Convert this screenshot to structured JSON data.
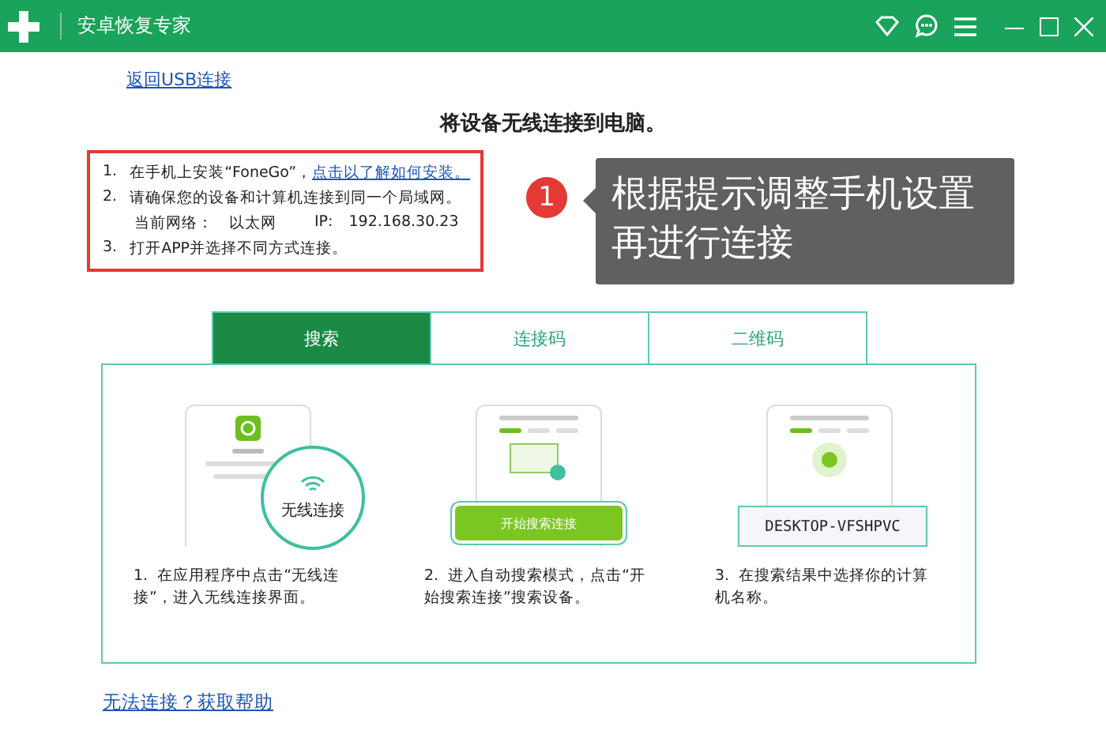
{
  "window": {
    "title": "安卓恢复专家"
  },
  "back_link": "返回USB连接",
  "heading": "将设备无线连接到电脑。",
  "instructions": [
    {
      "number": "1.",
      "text": "在手机上安装“FoneGo”，",
      "link": "点击以了解如何安装。"
    },
    {
      "number": "2.",
      "text": "请确保您的设备和计算机连接到同一个局域网。",
      "network_label": "当前网络：",
      "network": "以太网",
      "ip_label": "IP:",
      "ip": "192.168.30.23"
    },
    {
      "number": "3.",
      "text": "打开APP并选择不同方式连接。"
    }
  ],
  "annotation": {
    "badge": "1",
    "text": "根据提示调整手机设置再进行连接"
  },
  "tabs": [
    {
      "label": "搜索",
      "selected": true
    },
    {
      "label": "连接码",
      "selected": false
    },
    {
      "label": "二维码",
      "selected": false
    }
  ],
  "steps": [
    {
      "kind": "app",
      "overlay": "无线连接",
      "number": "1.",
      "caption": "在应用程序中点击“无线连接”，进入无线连接界面。"
    },
    {
      "kind": "search",
      "overlay": "开始搜索连接",
      "number": "2.",
      "caption": "进入自动搜索模式，点击“开始搜索连接”搜索设备。"
    },
    {
      "kind": "result",
      "overlay": "DESKTOP-VFSHPVC",
      "number": "3.",
      "caption": "在搜索结果中选择你的计算机名称。"
    }
  ],
  "help_link": "无法连接？获取帮助"
}
